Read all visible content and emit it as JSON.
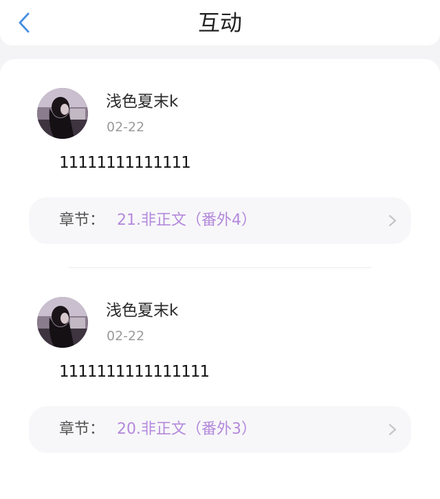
{
  "header": {
    "title": "互动",
    "back_icon": "chevron-left-icon",
    "accent_color": "#4a90e2"
  },
  "comments": [
    {
      "username": "浅色夏末k",
      "date": "02-22",
      "content": "11111111111111",
      "chapter_label": "章节：",
      "chapter_title": "21.非正文（番外4）"
    },
    {
      "username": "浅色夏末k",
      "date": "02-22",
      "content": "1111111111111111",
      "chapter_label": "章节：",
      "chapter_title": "20.非正文（番外3）"
    }
  ],
  "colors": {
    "chapter_title": "#b388dc",
    "date": "#9a9a9a"
  }
}
